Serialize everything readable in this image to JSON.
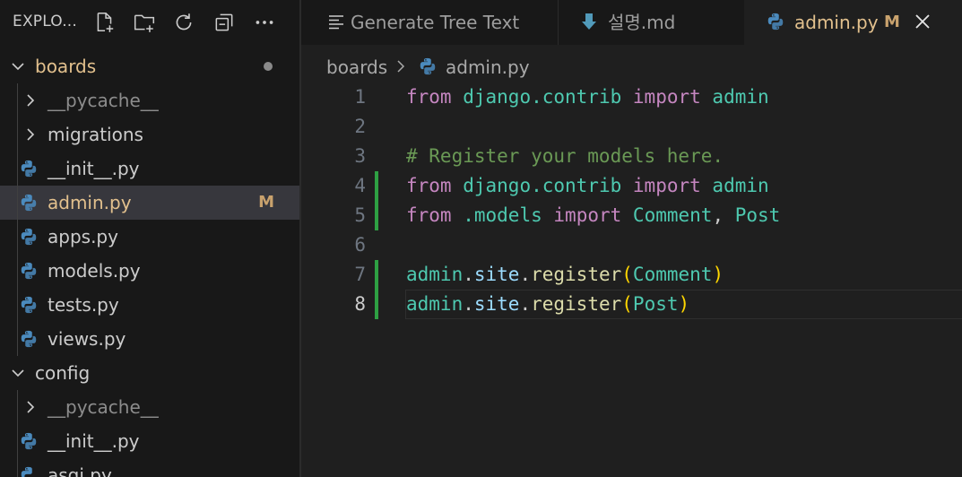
{
  "explorer": {
    "title": "EXPLO...",
    "icons": [
      "new-file-icon",
      "new-folder-icon",
      "refresh-icon",
      "collapse-all-icon",
      "more-icon"
    ]
  },
  "tree": [
    {
      "label": "boards",
      "kind": "folder-open",
      "status": "dot"
    },
    {
      "label": "__pycache__",
      "kind": "folder-closed",
      "dim": true
    },
    {
      "label": "migrations",
      "kind": "folder-closed"
    },
    {
      "label": "__init__.py",
      "kind": "python"
    },
    {
      "label": "admin.py",
      "kind": "python",
      "badge": "M",
      "selected": true
    },
    {
      "label": "apps.py",
      "kind": "python"
    },
    {
      "label": "models.py",
      "kind": "python"
    },
    {
      "label": "tests.py",
      "kind": "python"
    },
    {
      "label": "views.py",
      "kind": "python"
    },
    {
      "label": "config",
      "kind": "folder-open"
    },
    {
      "label": "__pycache__",
      "kind": "folder-closed",
      "dim": true
    },
    {
      "label": "__init__.py",
      "kind": "python"
    },
    {
      "label": "asgi.py",
      "kind": "python"
    }
  ],
  "tabs": [
    {
      "label": "Generate Tree Text",
      "icon": "lines-icon"
    },
    {
      "label": "설명.md",
      "icon": "markdown-icon"
    },
    {
      "label": "admin.py",
      "icon": "python-icon",
      "badge": "M",
      "active": true
    }
  ],
  "breadcrumb": {
    "folder": "boards",
    "file": "admin.py"
  },
  "editor": {
    "lines": [
      {
        "num": "1"
      },
      {
        "num": "2"
      },
      {
        "num": "3"
      },
      {
        "num": "4"
      },
      {
        "num": "5"
      },
      {
        "num": "6"
      },
      {
        "num": "7"
      },
      {
        "num": "8"
      }
    ],
    "tokens": {
      "from": "from",
      "import": "import",
      "django_contrib": "django.contrib",
      "admin": "admin",
      "comment": "# Register your models here.",
      "dot_models": ".models",
      "Comment": "Comment",
      "Post": "Post",
      "comma": ",",
      "site": "site",
      "register": "register",
      "dot": ".",
      "lparen": "(",
      "rparen": ")"
    }
  },
  "colors": {
    "modified": "#e2c08d",
    "added_gutter": "#2ea043",
    "keyword": "#c586c0",
    "module": "#4ec9b0",
    "comment": "#6a9955",
    "function": "#dcdcaa"
  }
}
